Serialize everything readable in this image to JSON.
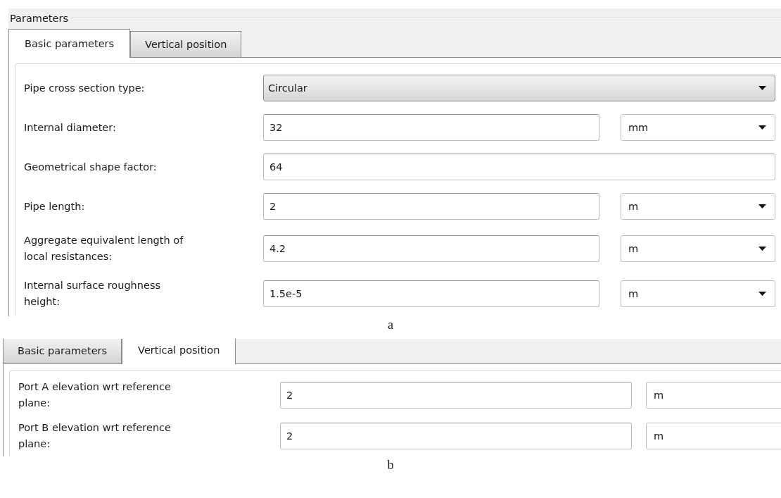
{
  "panels": [
    {
      "group_title": "Parameters",
      "tabs": [
        {
          "label": "Basic parameters",
          "selected": true
        },
        {
          "label": "Vertical position",
          "selected": false
        }
      ],
      "rows": [
        {
          "kind": "select",
          "label": "Pipe cross section type:",
          "value": "Circular"
        },
        {
          "kind": "value_unit",
          "label": "Internal diameter:",
          "value": "32",
          "unit": "mm"
        },
        {
          "kind": "value",
          "label": "Geometrical shape factor:",
          "value": "64"
        },
        {
          "kind": "value_unit",
          "label": "Pipe length:",
          "value": "2",
          "unit": "m"
        },
        {
          "kind": "value_unit",
          "label": "Aggregate equivalent length of local resistances:",
          "value": "4.2",
          "unit": "m"
        },
        {
          "kind": "value_unit",
          "label": "Internal surface roughness height:",
          "value": "1.5e-5",
          "unit": "m"
        }
      ],
      "caption": "a"
    },
    {
      "tabs": [
        {
          "label": "Basic parameters",
          "selected": false
        },
        {
          "label": "Vertical position",
          "selected": true
        }
      ],
      "rows": [
        {
          "kind": "value_unit",
          "label": "Port A elevation wrt reference plane:",
          "value": "2",
          "unit": "m"
        },
        {
          "kind": "value_unit",
          "label": "Port B elevation wrt reference plane:",
          "value": "2",
          "unit": "m"
        }
      ],
      "caption": "b"
    }
  ]
}
